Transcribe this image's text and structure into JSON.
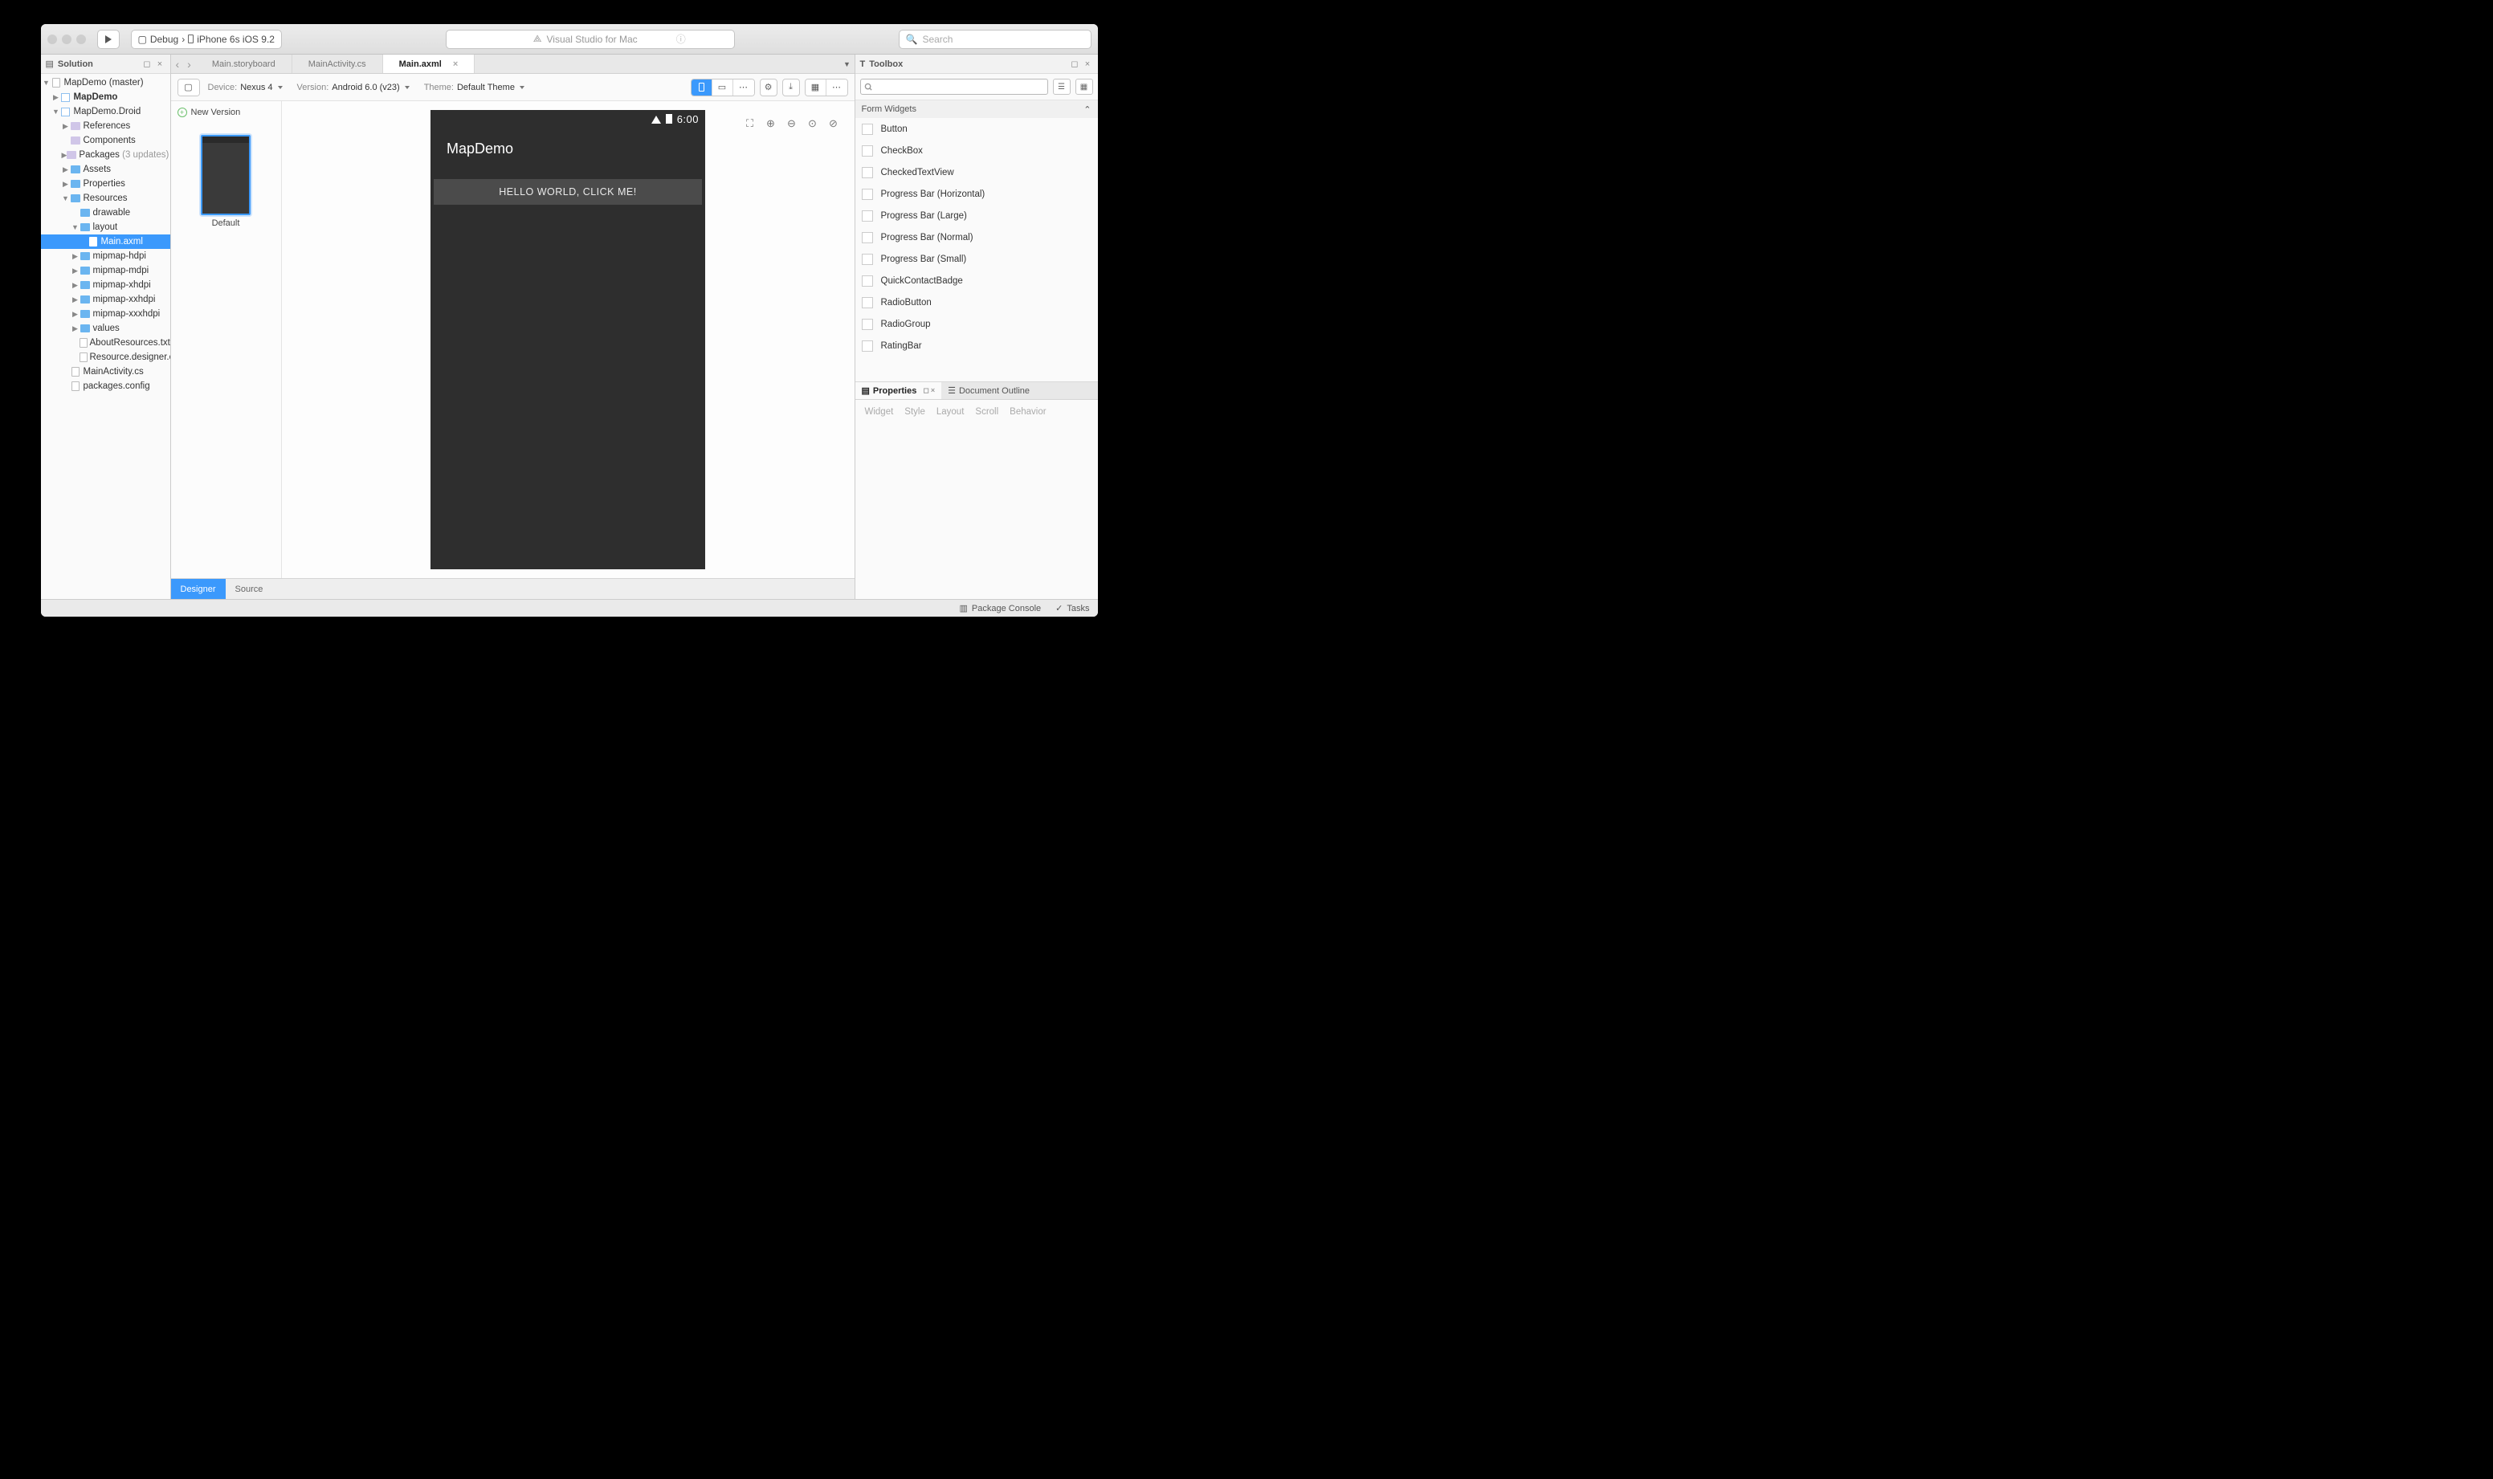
{
  "titlebar": {
    "config": "Debug",
    "target": "iPhone 6s iOS 9.2",
    "center": "Visual Studio for Mac",
    "search_placeholder": "Search"
  },
  "solution": {
    "head": "Solution",
    "tree": {
      "root": "MapDemo (master)",
      "proj1": "MapDemo",
      "proj2": "MapDemo.Droid",
      "refs": "References",
      "components": "Components",
      "packages": "Packages",
      "packages_note": "(3 updates)",
      "assets": "Assets",
      "properties": "Properties",
      "resources": "Resources",
      "drawable": "drawable",
      "layout": "layout",
      "main_axml": "Main.axml",
      "mip1": "mipmap-hdpi",
      "mip2": "mipmap-mdpi",
      "mip3": "mipmap-xhdpi",
      "mip4": "mipmap-xxhdpi",
      "mip5": "mipmap-xxxhdpi",
      "values": "values",
      "about": "AboutResources.txt",
      "designer": "Resource.designer.cs",
      "mainact": "MainActivity.cs",
      "pkgcfg": "packages.config"
    }
  },
  "tabs": {
    "t1": "Main.storyboard",
    "t2": "MainActivity.cs",
    "t3": "Main.axml"
  },
  "designer": {
    "device_lbl": "Device:",
    "device_val": "Nexus 4",
    "version_lbl": "Version:",
    "version_val": "Android 6.0 (v23)",
    "theme_lbl": "Theme:",
    "theme_val": "Default Theme",
    "new_version": "New Version",
    "thumb_label": "Default"
  },
  "phone": {
    "time": "6:00",
    "app_title": "MapDemo",
    "button": "HELLO WORLD, CLICK ME!"
  },
  "bottom_tabs": {
    "designer": "Designer",
    "source": "Source"
  },
  "toolbox": {
    "head": "Toolbox",
    "group": "Form Widgets",
    "items": [
      "Button",
      "CheckBox",
      "CheckedTextView",
      "Progress Bar (Horizontal)",
      "Progress Bar (Large)",
      "Progress Bar (Normal)",
      "Progress Bar (Small)",
      "QuickContactBadge",
      "RadioButton",
      "RadioGroup",
      "RatingBar"
    ]
  },
  "properties": {
    "tab1": "Properties",
    "tab2": "Document Outline",
    "subs": [
      "Widget",
      "Style",
      "Layout",
      "Scroll",
      "Behavior"
    ]
  },
  "status": {
    "pkg": "Package Console",
    "tasks": "Tasks"
  }
}
